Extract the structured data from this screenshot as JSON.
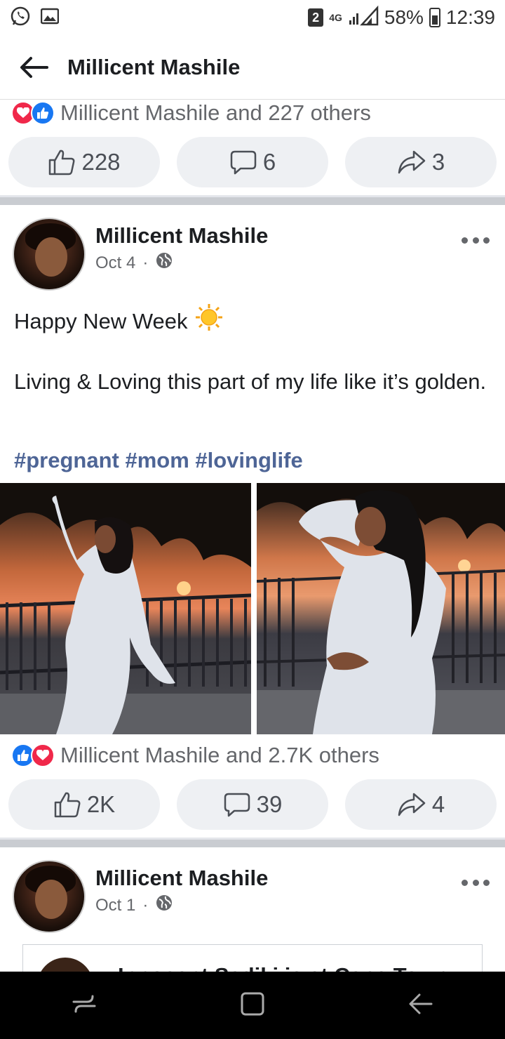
{
  "status_bar": {
    "sim": "2",
    "network": "4G",
    "battery": "58%",
    "time": "12:39"
  },
  "header": {
    "title": "Millicent Mashile"
  },
  "prev_post": {
    "reactions_text": "Millicent Mashile and 227 others",
    "like_count": "228",
    "comment_count": "6",
    "share_count": "3"
  },
  "post": {
    "author": "Millicent Mashile",
    "date": "Oct 4",
    "text_line1": "Happy New Week",
    "text_line2": "Living & Loving this part of my life like it’s golden.",
    "hashtags": "#pregnant #mom #lovinglife",
    "reactions_text": "Millicent Mashile and 2.7K others",
    "like_count": "2K",
    "comment_count": "39",
    "share_count": "4"
  },
  "next_post": {
    "author": "Millicent Mashile",
    "date": "Oct 1",
    "shared_preview": "Innocent Sadiki is at Cape Town"
  },
  "colors": {
    "link": "#4e6596",
    "like_blue": "#1877f2",
    "love_red": "#f0284a",
    "button_bg": "#eef0f3"
  }
}
